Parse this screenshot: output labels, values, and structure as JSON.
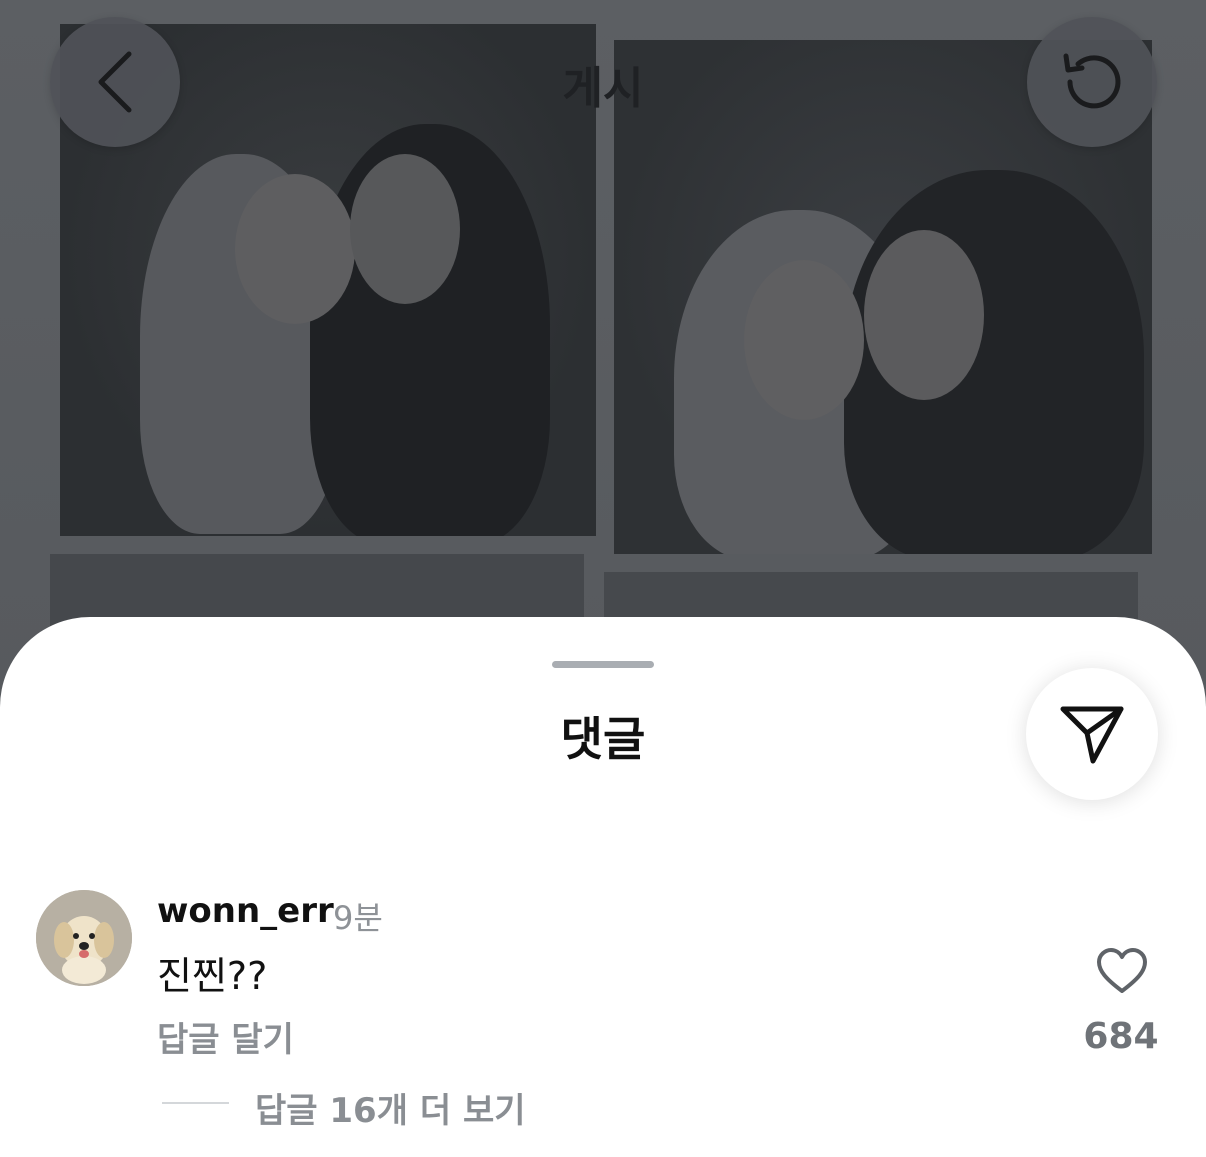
{
  "header": {
    "title": "게시",
    "back_icon": "chevron-left-icon",
    "refresh_icon": "refresh-icon"
  },
  "sheet": {
    "title": "댓글",
    "share_icon": "send-icon"
  },
  "comment": {
    "username": "wonn_err",
    "time": "9분",
    "text": "진찐??",
    "reply_label": "답글 달기",
    "like_count": "684",
    "like_icon": "heart-icon",
    "avatar_icon": "dog-avatar",
    "view_replies_label": "답글 16개 더 보기"
  }
}
